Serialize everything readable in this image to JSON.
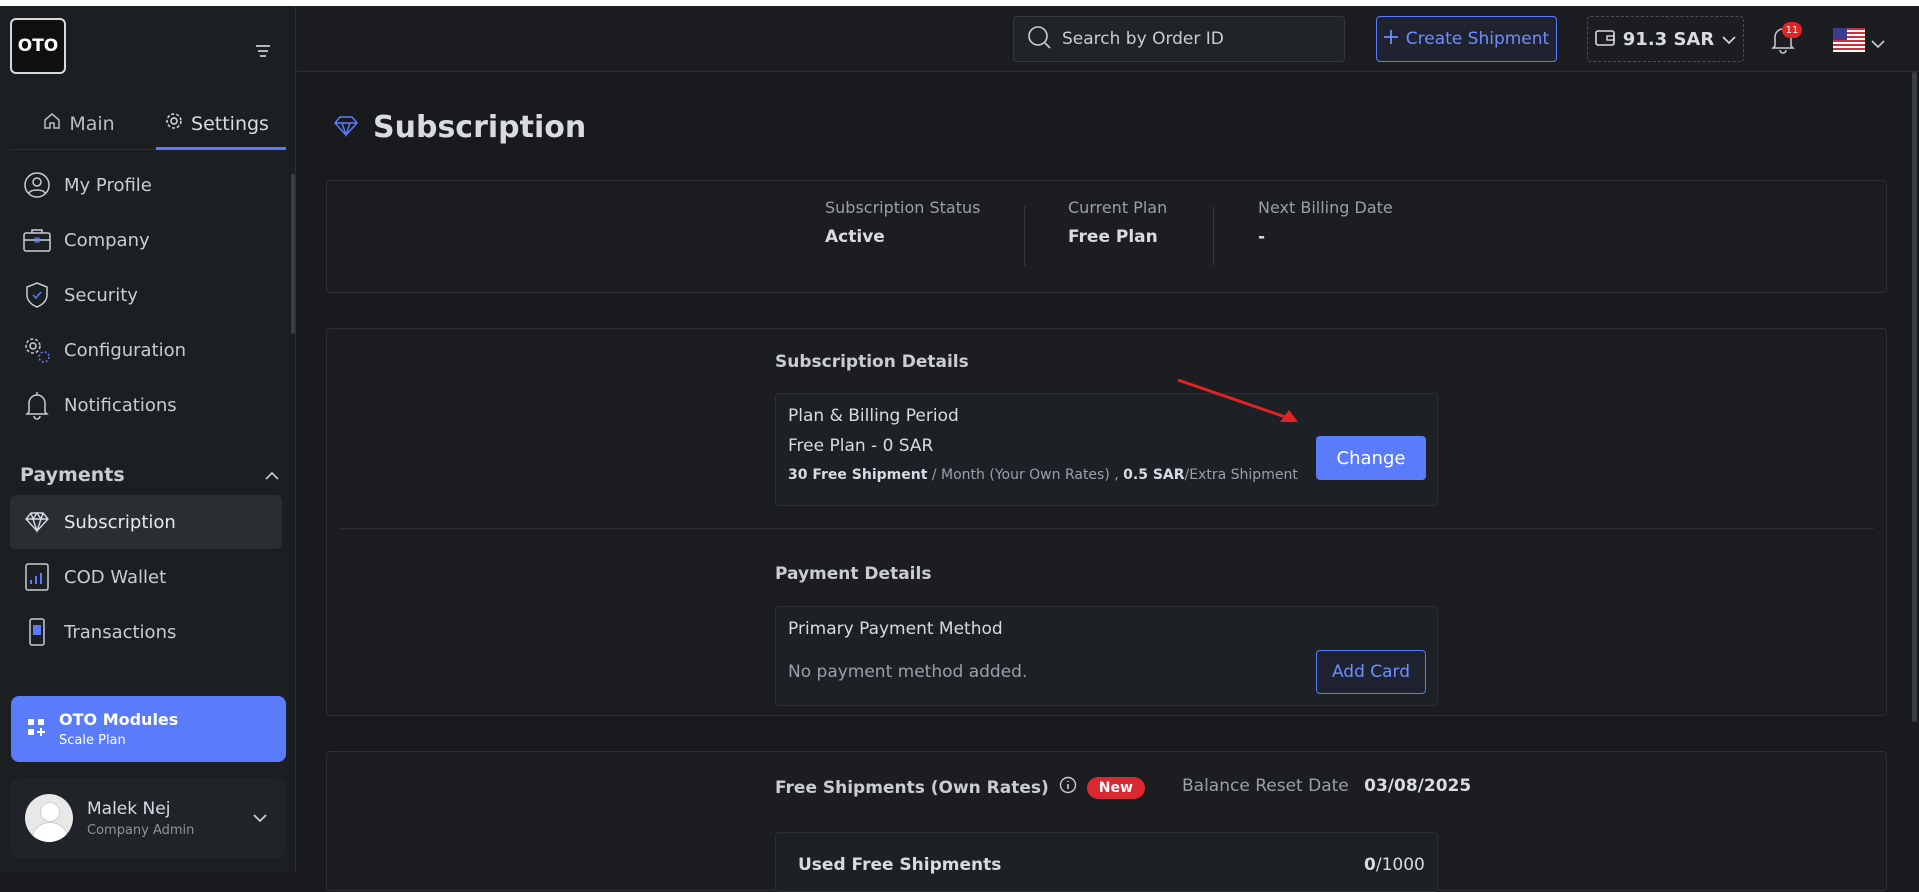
{
  "colors": {
    "accent": "#5b7cfa",
    "danger": "#e02424",
    "background": "#181a1d"
  },
  "logo": {
    "text": "OTO"
  },
  "tabs": [
    {
      "label": "Main",
      "icon": "home-icon"
    },
    {
      "label": "Settings",
      "icon": "gear-icon"
    }
  ],
  "sidebar": {
    "items": [
      {
        "label": "My Profile",
        "icon": "user-icon"
      },
      {
        "label": "Company",
        "icon": "briefcase-icon"
      },
      {
        "label": "Security",
        "icon": "shield-icon"
      },
      {
        "label": "Configuration",
        "icon": "gears-icon"
      },
      {
        "label": "Notifications",
        "icon": "bell-icon"
      }
    ],
    "payments_title": "Payments",
    "payments_items": [
      {
        "label": "Subscription",
        "icon": "diamond-icon",
        "active": true
      },
      {
        "label": "COD Wallet",
        "icon": "wallet-chart-icon"
      },
      {
        "label": "Transactions",
        "icon": "phone-card-icon"
      }
    ],
    "modules": {
      "title": "OTO Modules",
      "subtitle": "Scale Plan"
    },
    "user": {
      "name": "Malek Nej",
      "role": "Company Admin"
    }
  },
  "topbar": {
    "search_placeholder": "Search by Order ID",
    "create_label": "Create Shipment",
    "balance": "91.3 SAR",
    "notification_count": "11"
  },
  "page": {
    "title": "Subscription",
    "status": {
      "subscription_status_label": "Subscription Status",
      "subscription_status_value": "Active",
      "current_plan_label": "Current Plan",
      "current_plan_value": "Free Plan",
      "next_billing_label": "Next Billing Date",
      "next_billing_value": "-"
    },
    "subscription_details": {
      "heading": "Subscription Details",
      "card_title": "Plan & Billing Period",
      "plan": "Free Plan - 0 SAR",
      "free_shipments_bold": "30 Free Shipment",
      "free_shipments_rest": " / Month (Your Own Rates) , ",
      "extra_bold": "0.5 SAR",
      "extra_rest": "/Extra Shipment",
      "change_label": "Change"
    },
    "payment_details": {
      "heading": "Payment Details",
      "card_title": "Primary Payment Method",
      "empty_text": "No payment method added.",
      "add_card_label": "Add Card"
    },
    "free_shipments": {
      "heading": "Free Shipments (Own Rates)",
      "badge": "New",
      "reset_label": "Balance Reset Date",
      "reset_date": "03/08/2025",
      "used_label": "Used Free Shipments",
      "used_value": "0",
      "total_value": "/1000"
    }
  }
}
